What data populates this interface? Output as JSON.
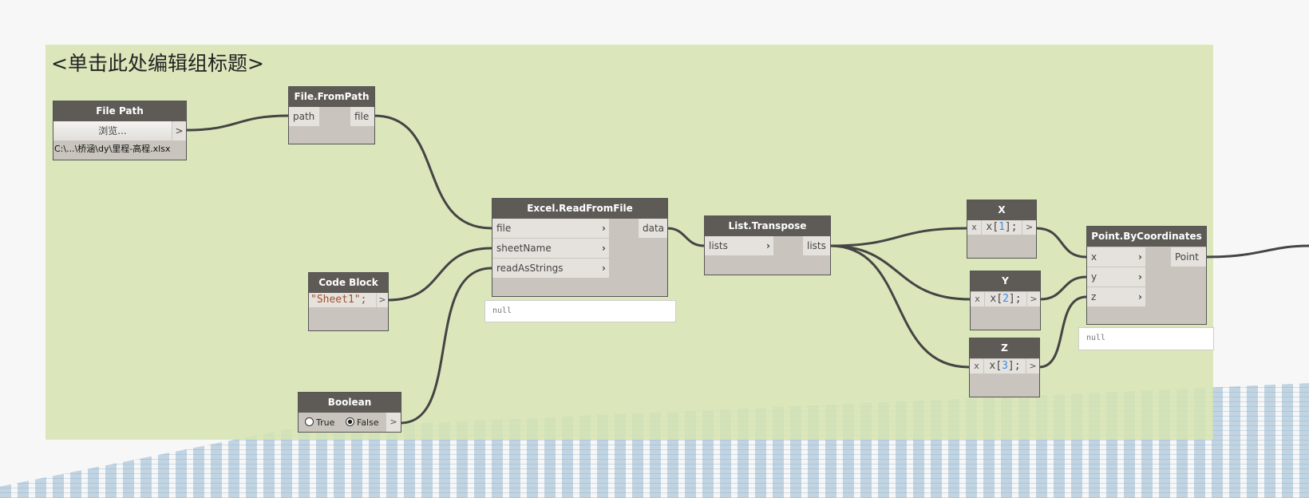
{
  "group": {
    "title": "<单击此处编辑组标题>"
  },
  "file_path": {
    "title": "File Path",
    "browse_label": "浏览...",
    "output": ">",
    "value": "C:\\...\\桥涵\\dy\\里程-高程.xlsx"
  },
  "file_from_path": {
    "title": "File.FromPath",
    "input": "path",
    "output": "file"
  },
  "excel_read": {
    "title": "Excel.ReadFromFile",
    "inputs": [
      "file",
      "sheetName",
      "readAsStrings"
    ],
    "output": "data",
    "preview": "null"
  },
  "code_block": {
    "title": "Code Block",
    "code": "\"Sheet1\";",
    "output": ">"
  },
  "boolean": {
    "title": "Boolean",
    "true_label": "True",
    "false_label": "False",
    "selected": "False",
    "output": ">"
  },
  "list_transpose": {
    "title": "List.Transpose",
    "input": "lists",
    "output": "lists"
  },
  "code_x": {
    "title": "X",
    "input": "x",
    "code_pre": "x[",
    "index": "1",
    "code_post": "];",
    "output": ">"
  },
  "code_y": {
    "title": "Y",
    "input": "x",
    "code_pre": "x[",
    "index": "2",
    "code_post": "];",
    "output": ">"
  },
  "code_z": {
    "title": "Z",
    "input": "x",
    "code_pre": "x[",
    "index": "3",
    "code_post": "];",
    "output": ">"
  },
  "point": {
    "title": "Point.ByCoordinates",
    "inputs": [
      "x",
      "y",
      "z"
    ],
    "output": "Point",
    "preview": "null"
  },
  "colors": {
    "group": "#d6e4b0",
    "header": "#5e5b57",
    "wire": "#444444"
  }
}
